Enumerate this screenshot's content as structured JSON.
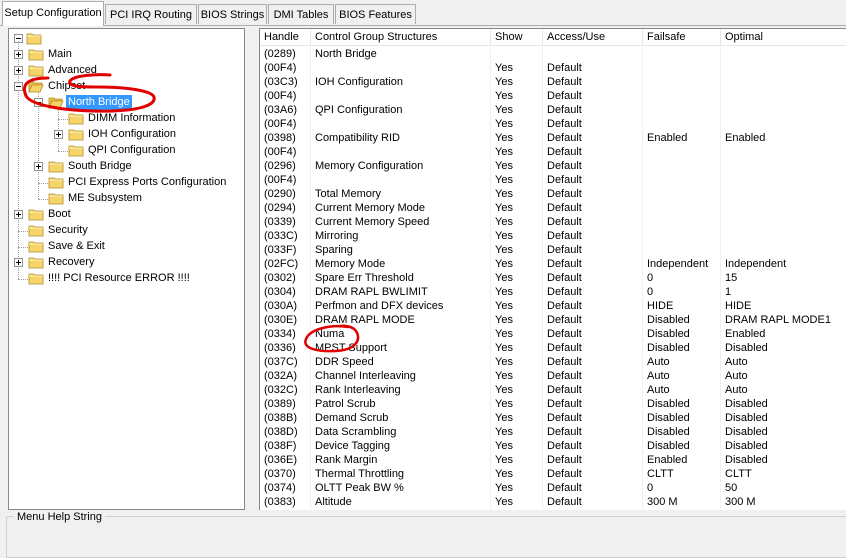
{
  "tabs": [
    {
      "label": "Setup Configuration",
      "active": true
    },
    {
      "label": "PCI IRQ Routing"
    },
    {
      "label": "BIOS Strings"
    },
    {
      "label": "DMI Tables"
    },
    {
      "label": "BIOS Features"
    }
  ],
  "tree": {
    "root": "",
    "items": [
      {
        "label": "Main",
        "expander": "plus"
      },
      {
        "label": "Advanced",
        "expander": "plus"
      },
      {
        "label": "Chipset",
        "expander": "minus"
      },
      {
        "label": "North Bridge",
        "expander": "minus",
        "selected": true
      },
      {
        "label": "DIMM Information"
      },
      {
        "label": "IOH Configuration",
        "expander": "plus"
      },
      {
        "label": "QPI Configuration"
      },
      {
        "label": "South Bridge",
        "expander": "plus"
      },
      {
        "label": "PCI Express Ports Configuration"
      },
      {
        "label": "ME Subsystem"
      },
      {
        "label": "Boot",
        "expander": "plus"
      },
      {
        "label": "Security"
      },
      {
        "label": "Save & Exit"
      },
      {
        "label": "Recovery",
        "expander": "plus"
      },
      {
        "label": "!!!! PCI Resource ERROR !!!!"
      }
    ]
  },
  "table": {
    "columns": [
      "Handle",
      "Control Group Structures",
      "Show",
      "Access/Use",
      "Failsafe",
      "Optimal"
    ],
    "rows": [
      [
        "(0289)",
        "North Bridge",
        "",
        "",
        "",
        ""
      ],
      [
        "(00F4)",
        "",
        "Yes",
        "Default",
        "",
        ""
      ],
      [
        "(03C3)",
        "IOH Configuration",
        "Yes",
        "Default",
        "",
        ""
      ],
      [
        "(00F4)",
        "",
        "Yes",
        "Default",
        "",
        ""
      ],
      [
        "(03A6)",
        "QPI Configuration",
        "Yes",
        "Default",
        "",
        ""
      ],
      [
        "(00F4)",
        "",
        "Yes",
        "Default",
        "",
        ""
      ],
      [
        "(0398)",
        "Compatibility RID",
        "Yes",
        "Default",
        "Enabled",
        "Enabled"
      ],
      [
        "(00F4)",
        "",
        "Yes",
        "Default",
        "",
        ""
      ],
      [
        "(0296)",
        "Memory Configuration",
        "Yes",
        "Default",
        "",
        ""
      ],
      [
        "(00F4)",
        "",
        "Yes",
        "Default",
        "",
        ""
      ],
      [
        "(0290)",
        "Total Memory",
        "Yes",
        "Default",
        "",
        ""
      ],
      [
        "(0294)",
        "Current Memory Mode",
        "Yes",
        "Default",
        "",
        ""
      ],
      [
        "(0339)",
        "Current Memory Speed",
        "Yes",
        "Default",
        "",
        ""
      ],
      [
        "(033C)",
        "Mirroring",
        "Yes",
        "Default",
        "",
        ""
      ],
      [
        "(033F)",
        "Sparing",
        "Yes",
        "Default",
        "",
        ""
      ],
      [
        "(02FC)",
        "Memory Mode",
        "Yes",
        "Default",
        "Independent",
        "Independent"
      ],
      [
        "(0302)",
        "Spare Err Threshold",
        "Yes",
        "Default",
        "0",
        "15"
      ],
      [
        "(0304)",
        "DRAM RAPL BWLIMIT",
        "Yes",
        "Default",
        "0",
        "1"
      ],
      [
        "(030A)",
        "Perfmon and DFX devices",
        "Yes",
        "Default",
        "HIDE",
        "HIDE"
      ],
      [
        "(030E)",
        "DRAM RAPL MODE",
        "Yes",
        "Default",
        "Disabled",
        "DRAM RAPL MODE1"
      ],
      [
        "(0334)",
        "Numa",
        "Yes",
        "Default",
        "Disabled",
        "Enabled"
      ],
      [
        "(0336)",
        "MPST Support",
        "Yes",
        "Default",
        "Disabled",
        "Disabled"
      ],
      [
        "(037C)",
        "DDR Speed",
        "Yes",
        "Default",
        "Auto",
        "Auto"
      ],
      [
        "(032A)",
        "Channel Interleaving",
        "Yes",
        "Default",
        "Auto",
        "Auto"
      ],
      [
        "(032C)",
        "Rank Interleaving",
        "Yes",
        "Default",
        "Auto",
        "Auto"
      ],
      [
        "(0389)",
        "Patrol Scrub",
        "Yes",
        "Default",
        "Disabled",
        "Disabled"
      ],
      [
        "(038B)",
        "Demand Scrub",
        "Yes",
        "Default",
        "Disabled",
        "Disabled"
      ],
      [
        "(038D)",
        "Data Scrambling",
        "Yes",
        "Default",
        "Disabled",
        "Disabled"
      ],
      [
        "(038F)",
        "Device Tagging",
        "Yes",
        "Default",
        "Disabled",
        "Disabled"
      ],
      [
        "(036E)",
        "Rank Margin",
        "Yes",
        "Default",
        "Enabled",
        "Disabled"
      ],
      [
        "(0370)",
        "Thermal Throttling",
        "Yes",
        "Default",
        "CLTT",
        "CLTT"
      ],
      [
        "(0374)",
        "OLTT Peak BW %",
        "Yes",
        "Default",
        "0",
        "50"
      ],
      [
        "(0383)",
        "Altitude",
        "Yes",
        "Default",
        "300 M",
        "300 M"
      ]
    ]
  },
  "help": {
    "label": "Menu Help String"
  },
  "colors": {
    "selection": "#3399ff",
    "annotation": "#e00000",
    "folder": "#f5d56a"
  }
}
